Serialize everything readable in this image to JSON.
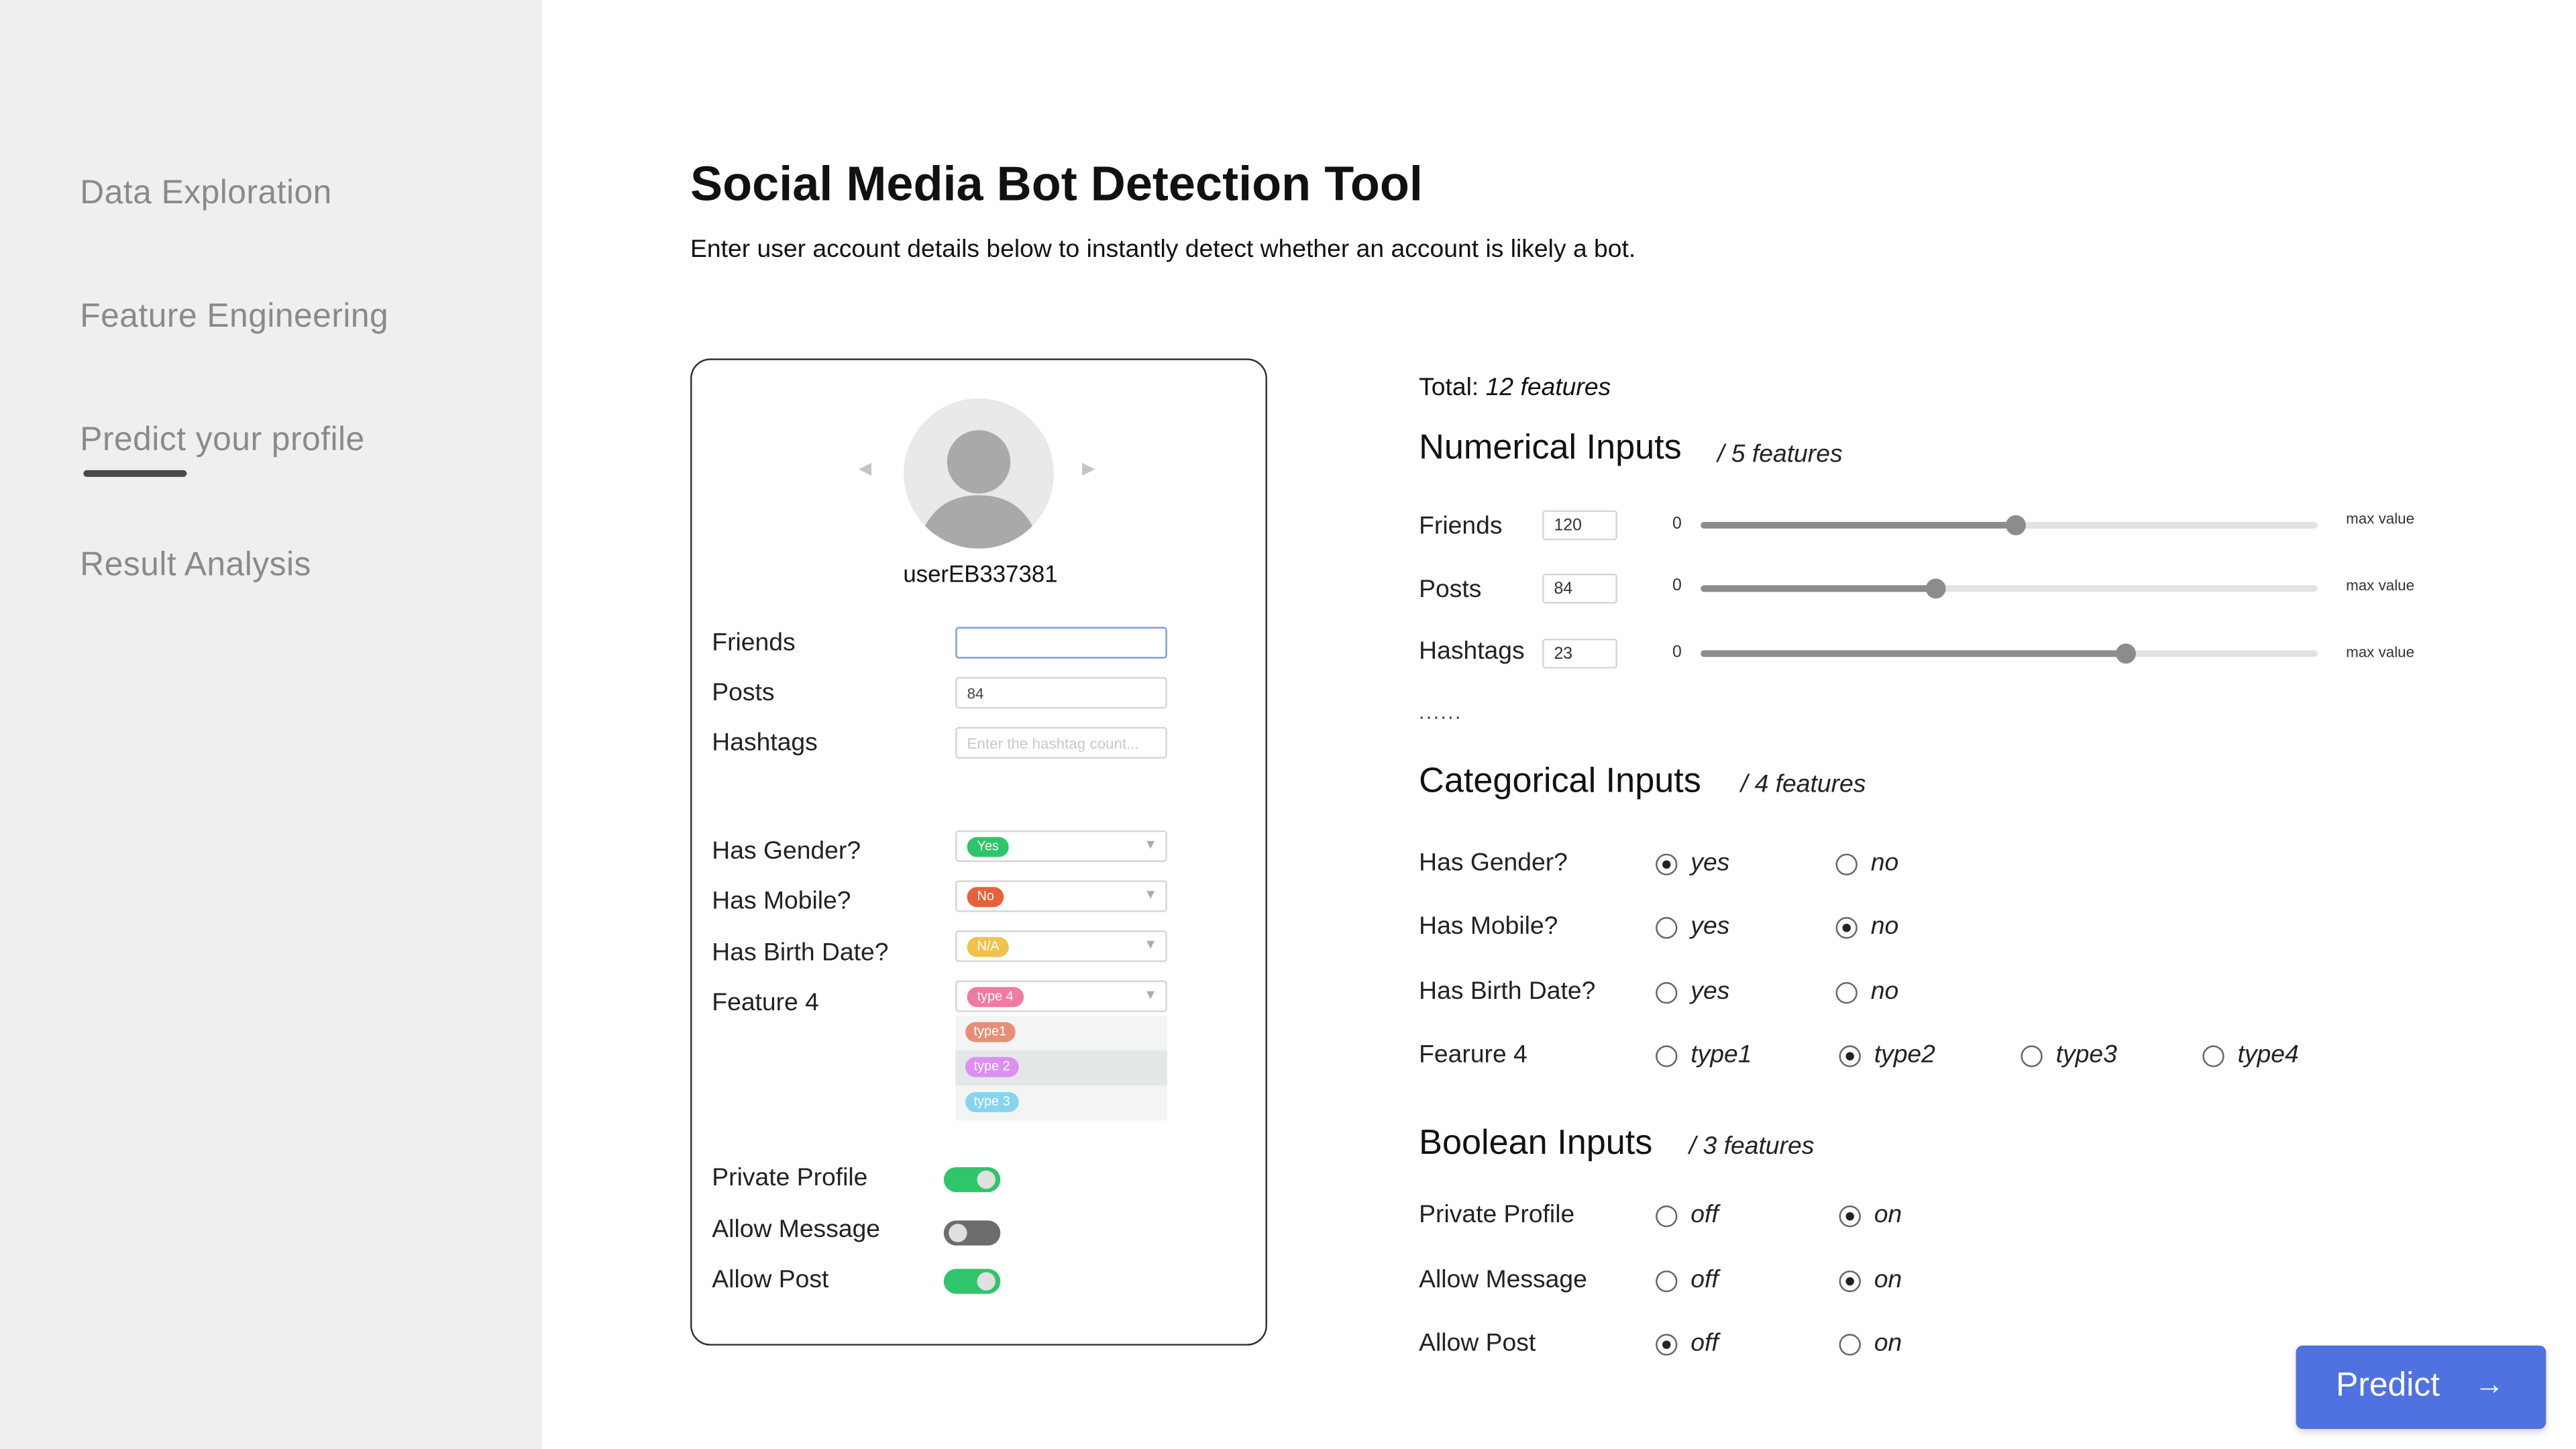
{
  "sidebar": {
    "items": [
      {
        "label": "Data Exploration"
      },
      {
        "label": "Feature Engineering"
      },
      {
        "label": "Predict your profile",
        "active": true
      },
      {
        "label": "Result Analysis"
      }
    ]
  },
  "header": {
    "title": "Social Media Bot Detection Tool",
    "subtitle": "Enter user account details below to instantly detect whether an account is likely a bot."
  },
  "card": {
    "username": "userEB337381",
    "avatar_icon": "user-icon",
    "fields": {
      "friends": {
        "label": "Friends",
        "value": ""
      },
      "posts": {
        "label": "Posts",
        "value": "84"
      },
      "hashtags": {
        "label": "Hashtags",
        "value": "",
        "placeholder": "Enter the hashtag count..."
      }
    },
    "selects": {
      "has_gender": {
        "label": "Has Gender?",
        "value": "Yes",
        "color": "#2fc56b"
      },
      "has_mobile": {
        "label": "Has Mobile?",
        "value": "No",
        "color": "#e8603c"
      },
      "has_birth_date": {
        "label": "Has Birth Date?",
        "value": "N/A",
        "color": "#f0c24a"
      },
      "feature4": {
        "label": "Feature 4",
        "value": "type 4",
        "color": "#f07aa0"
      }
    },
    "feature4_options": [
      {
        "label": "type1",
        "color": "#e88e78"
      },
      {
        "label": "type 2",
        "color": "#dc8ef2",
        "selected": true
      },
      {
        "label": "type 3",
        "color": "#86d4f0"
      }
    ],
    "toggles": {
      "private_profile": {
        "label": "Private Profile",
        "on": true
      },
      "allow_message": {
        "label": "Allow Message",
        "on": false
      },
      "allow_post": {
        "label": "Allow Post",
        "on": true
      }
    }
  },
  "panel": {
    "total_label": "Total:",
    "total_value": "12 features",
    "numerical": {
      "title": "Numerical Inputs",
      "count": "/ 5 features",
      "rows": [
        {
          "label": "Friends",
          "value": "120",
          "min": "0",
          "max_label": "max value",
          "fraction": 0.51
        },
        {
          "label": "Posts",
          "value": "84",
          "min": "0",
          "max_label": "max value",
          "fraction": 0.38
        },
        {
          "label": "Hashtags",
          "value": "23",
          "min": "0",
          "max_label": "max value",
          "fraction": 0.69
        }
      ],
      "more": "......"
    },
    "categorical": {
      "title": "Categorical Inputs",
      "count": "/ 4 features",
      "rows": [
        {
          "label": "Has Gender?",
          "options": [
            "yes",
            "no"
          ],
          "selected": "yes"
        },
        {
          "label": "Has Mobile?",
          "options": [
            "yes",
            "no"
          ],
          "selected": "no"
        },
        {
          "label": "Has Birth Date?",
          "options": [
            "yes",
            "no"
          ],
          "selected": null
        },
        {
          "label": "Fearure 4",
          "options": [
            "type1",
            "type2",
            "type3",
            "type4"
          ],
          "selected": "type2"
        }
      ]
    },
    "boolean": {
      "title": "Boolean Inputs",
      "count": "/ 3 features",
      "rows": [
        {
          "label": "Private Profile",
          "options": [
            "off",
            "on"
          ],
          "selected": "on"
        },
        {
          "label": "Allow Message",
          "options": [
            "off",
            "on"
          ],
          "selected": "on"
        },
        {
          "label": "Allow Post",
          "options": [
            "off",
            "on"
          ],
          "selected": "off"
        }
      ]
    }
  },
  "predict": {
    "label": "Predict",
    "icon": "arrow-right-icon"
  }
}
